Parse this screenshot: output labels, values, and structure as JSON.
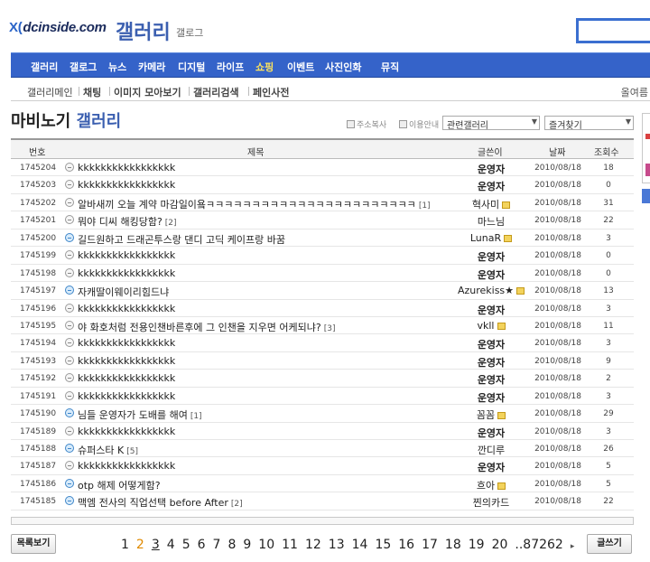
{
  "header": {
    "logo": "dcinside.com",
    "logo_mark": "X(",
    "title": "갤러리",
    "gallog": "갤로그"
  },
  "nav": [
    "갤러리",
    "갤로그",
    "뉴스",
    "카메라",
    "디지털",
    "라이프",
    "쇼핑",
    "이벤트",
    "사진인화",
    "뮤직"
  ],
  "nav_active": "쇼핑",
  "subnav": {
    "items": [
      "갤러리메인",
      "채팅",
      "이미지 모아보기",
      "갤러리검색",
      "페인사전"
    ],
    "right": "올여름"
  },
  "page": {
    "title": "마비노기",
    "title_accent": "갤러리",
    "copy_address": "주소복사",
    "usage_guide": "이용안내",
    "related_select": "관련갤러리",
    "favorites_select": "즐겨찾기"
  },
  "table": {
    "headers": {
      "num": "번호",
      "subject": "제목",
      "writer": "글쓴이",
      "date": "날짜",
      "views": "조회수"
    },
    "rows": [
      {
        "num": "1745204",
        "subject": "kkkkkkkkkkkkkkkkk",
        "comments": "",
        "writer": "운영자",
        "fixed": true,
        "gallog": false,
        "img": false,
        "date": "2010/08/18",
        "views": "18"
      },
      {
        "num": "1745203",
        "subject": "kkkkkkkkkkkkkkkkk",
        "comments": "",
        "writer": "운영자",
        "fixed": true,
        "gallog": false,
        "img": false,
        "date": "2010/08/18",
        "views": "0"
      },
      {
        "num": "1745202",
        "subject": "알바새끼 오늘 계약 마감일이욬ㅋㅋㅋㅋㅋㅋㅋㅋㅋㅋㅋㅋㅋㅋㅋㅋㅋㅋㅋㅋㅋㅋㅋ",
        "comments": "[1]",
        "writer": "혁사미",
        "fixed": false,
        "gallog": true,
        "img": false,
        "date": "2010/08/18",
        "views": "31"
      },
      {
        "num": "1745201",
        "subject": "뭐야 디씨 해킹당함?",
        "comments": "[2]",
        "writer": "마느님",
        "fixed": false,
        "gallog": false,
        "img": false,
        "date": "2010/08/18",
        "views": "22"
      },
      {
        "num": "1745200",
        "subject": "길드원하고 드래곤투스랑 댄디 고딕 케이프랑 바꿈",
        "comments": "",
        "writer": "LunaR",
        "fixed": false,
        "gallog": true,
        "img": true,
        "date": "2010/08/18",
        "views": "3"
      },
      {
        "num": "1745199",
        "subject": "kkkkkkkkkkkkkkkkk",
        "comments": "",
        "writer": "운영자",
        "fixed": true,
        "gallog": false,
        "img": false,
        "date": "2010/08/18",
        "views": "0"
      },
      {
        "num": "1745198",
        "subject": "kkkkkkkkkkkkkkkkk",
        "comments": "",
        "writer": "운영자",
        "fixed": true,
        "gallog": false,
        "img": false,
        "date": "2010/08/18",
        "views": "0"
      },
      {
        "num": "1745197",
        "subject": "자캐딸이웨이리힘드냐",
        "comments": "",
        "writer": "Azurekiss★",
        "fixed": false,
        "gallog": true,
        "img": true,
        "date": "2010/08/18",
        "views": "13"
      },
      {
        "num": "1745196",
        "subject": "kkkkkkkkkkkkkkkkk",
        "comments": "",
        "writer": "운영자",
        "fixed": true,
        "gallog": false,
        "img": false,
        "date": "2010/08/18",
        "views": "3"
      },
      {
        "num": "1745195",
        "subject": "야 화호처럼 전용인챈바른후에 그 인챈을 지우면 어케되냐?",
        "comments": "[3]",
        "writer": "vkll",
        "fixed": false,
        "gallog": true,
        "img": false,
        "date": "2010/08/18",
        "views": "11"
      },
      {
        "num": "1745194",
        "subject": "kkkkkkkkkkkkkkkkk",
        "comments": "",
        "writer": "운영자",
        "fixed": true,
        "gallog": false,
        "img": false,
        "date": "2010/08/18",
        "views": "3"
      },
      {
        "num": "1745193",
        "subject": "kkkkkkkkkkkkkkkkk",
        "comments": "",
        "writer": "운영자",
        "fixed": true,
        "gallog": false,
        "img": false,
        "date": "2010/08/18",
        "views": "9"
      },
      {
        "num": "1745192",
        "subject": "kkkkkkkkkkkkkkkkk",
        "comments": "",
        "writer": "운영자",
        "fixed": true,
        "gallog": false,
        "img": false,
        "date": "2010/08/18",
        "views": "2"
      },
      {
        "num": "1745191",
        "subject": "kkkkkkkkkkkkkkkkk",
        "comments": "",
        "writer": "운영자",
        "fixed": true,
        "gallog": false,
        "img": false,
        "date": "2010/08/18",
        "views": "3"
      },
      {
        "num": "1745190",
        "subject": "님들 운영자가 도배를 해여",
        "comments": "[1]",
        "writer": "꼼꼼",
        "fixed": false,
        "gallog": true,
        "img": true,
        "date": "2010/08/18",
        "views": "29"
      },
      {
        "num": "1745189",
        "subject": "kkkkkkkkkkkkkkkkk",
        "comments": "",
        "writer": "운영자",
        "fixed": true,
        "gallog": false,
        "img": false,
        "date": "2010/08/18",
        "views": "3"
      },
      {
        "num": "1745188",
        "subject": "슈퍼스타 K",
        "comments": "[5]",
        "writer": "깐디루",
        "fixed": false,
        "gallog": false,
        "img": true,
        "date": "2010/08/18",
        "views": "26"
      },
      {
        "num": "1745187",
        "subject": "kkkkkkkkkkkkkkkkk",
        "comments": "",
        "writer": "운영자",
        "fixed": true,
        "gallog": false,
        "img": false,
        "date": "2010/08/18",
        "views": "5"
      },
      {
        "num": "1745186",
        "subject": "otp 해제 어떻게함?",
        "comments": "",
        "writer": "흐아",
        "fixed": false,
        "gallog": true,
        "img": true,
        "date": "2010/08/18",
        "views": "5"
      },
      {
        "num": "1745185",
        "subject": "맥엠 전사의 직업선택 before After",
        "comments": "[2]",
        "writer": "찐의카드",
        "fixed": false,
        "gallog": false,
        "img": true,
        "date": "2010/08/18",
        "views": "22"
      }
    ]
  },
  "footer": {
    "list_button": "목록보기",
    "write_button": "글쓰기",
    "pages": [
      "1",
      "2",
      "3",
      "4",
      "5",
      "6",
      "7",
      "8",
      "9",
      "10",
      "11",
      "12",
      "13",
      "14",
      "15",
      "16",
      "17",
      "18",
      "19",
      "20"
    ],
    "current_page": "2",
    "underlined_page": "3",
    "last_page": "..87262",
    "next_icon": "▸"
  }
}
